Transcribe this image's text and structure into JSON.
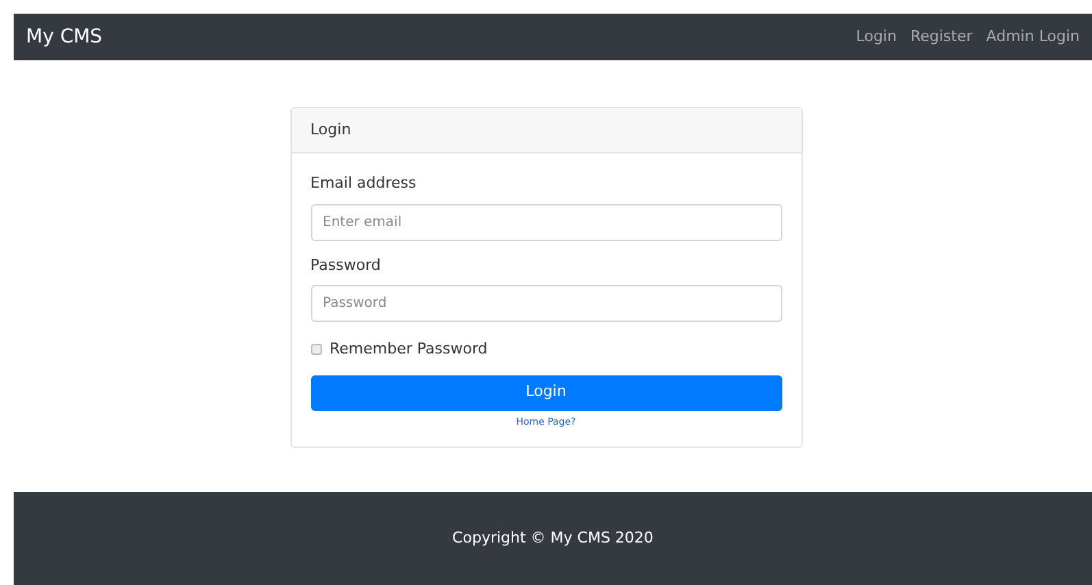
{
  "navbar": {
    "brand": "My CMS",
    "links": [
      "Login",
      "Register",
      "Admin Login"
    ]
  },
  "card": {
    "header": "Login",
    "fields": [
      {
        "label": "Email address",
        "placeholder": "Enter email"
      },
      {
        "label": "Password",
        "placeholder": "Password"
      }
    ],
    "remember": {
      "label": "Remember Password",
      "checked": false
    },
    "submit": "Login",
    "link": "Home Page?"
  },
  "footer": "Copyright © My CMS 2020"
}
